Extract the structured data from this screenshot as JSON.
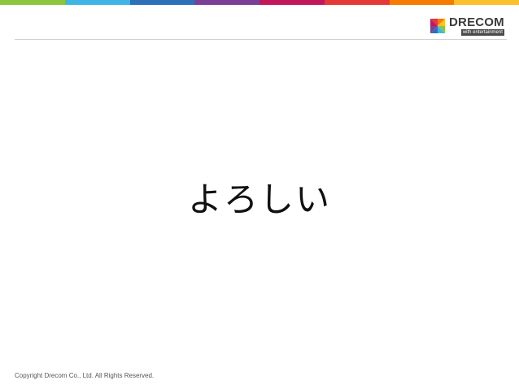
{
  "header": {
    "stripe_colors": [
      "#8cc63f",
      "#3fb5e6",
      "#2e6fba",
      "#7b3f98",
      "#c2185b",
      "#e53935",
      "#f57c00",
      "#fbc02d"
    ],
    "logo": {
      "wordmark": "DRECOM",
      "tagline": "with entertainment",
      "icon": "drecom-pinwheel-icon"
    }
  },
  "slide": {
    "title": "よろしい"
  },
  "footer": {
    "copyright": "Copyright Drecom Co., Ltd. All Rights Reserved."
  }
}
